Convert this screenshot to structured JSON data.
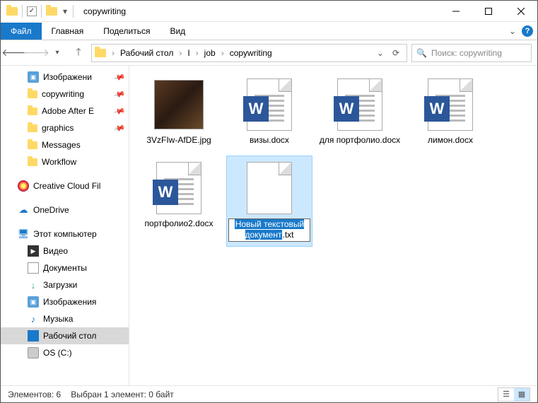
{
  "title": "copywriting",
  "ribbon": {
    "file": "Файл",
    "home": "Главная",
    "share": "Поделиться",
    "view": "Вид"
  },
  "breadcrumb": [
    "Рабочий стол",
    "I",
    "job",
    "copywriting"
  ],
  "search_placeholder": "Поиск: copywriting",
  "nav": {
    "quick": [
      {
        "label": "Изображени",
        "icon": "pic",
        "pinned": true
      },
      {
        "label": "copywriting",
        "icon": "folder",
        "pinned": true
      },
      {
        "label": "Adobe After E",
        "icon": "folder",
        "pinned": true
      },
      {
        "label": "graphics",
        "icon": "folder",
        "pinned": true
      },
      {
        "label": "Messages",
        "icon": "folder",
        "pinned": false
      },
      {
        "label": "Workflow",
        "icon": "folder",
        "pinned": false
      }
    ],
    "cc": "Creative Cloud Fil",
    "onedrive": "OneDrive",
    "pc": "Этот компьютер",
    "pc_children": [
      {
        "label": "Видео",
        "icon": "video"
      },
      {
        "label": "Документы",
        "icon": "doc"
      },
      {
        "label": "Загрузки",
        "icon": "dl"
      },
      {
        "label": "Изображения",
        "icon": "pic"
      },
      {
        "label": "Музыка",
        "icon": "music"
      },
      {
        "label": "Рабочий стол",
        "icon": "desk",
        "selected": true
      },
      {
        "label": "OS (C:)",
        "icon": "disk"
      }
    ]
  },
  "files": [
    {
      "name": "3VzFIw-AfDE.jpg",
      "type": "image"
    },
    {
      "name": "визы.docx",
      "type": "word"
    },
    {
      "name": "для портфолио.docx",
      "type": "word"
    },
    {
      "name": "лимон.docx",
      "type": "word"
    },
    {
      "name": "портфолио2.docx",
      "type": "word"
    },
    {
      "name_base": "Новый текстовый документ",
      "name_ext": ".txt",
      "type": "txt",
      "selected": true,
      "renaming": true
    }
  ],
  "status": {
    "count": "Элементов: 6",
    "selection": "Выбран 1 элемент: 0 байт"
  }
}
